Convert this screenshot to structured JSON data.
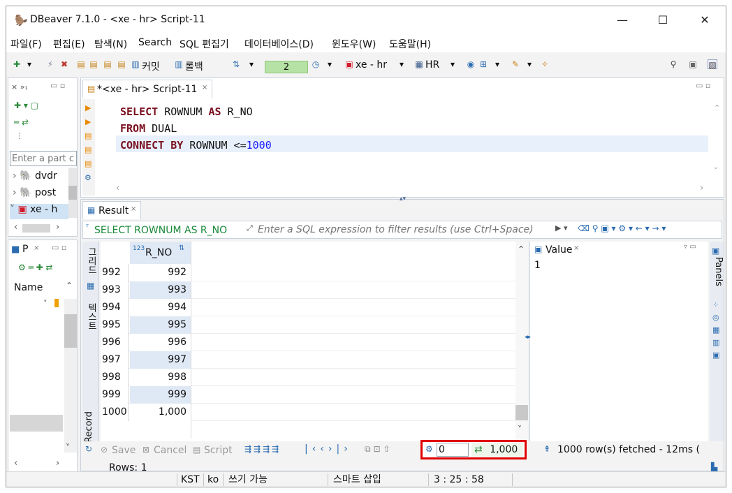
{
  "window": {
    "title": "DBeaver 7.1.0 - <xe - hr> Script-11",
    "controls": {
      "minimize": "—",
      "maximize": "☐",
      "close": "✕"
    }
  },
  "menu": [
    "파일(F)",
    "편집(E)",
    "탐색(N)",
    "Search",
    "SQL 편집기",
    "데이터베이스(D)",
    "윈도우(W)",
    "도움말(H)"
  ],
  "toolbar": {
    "commit_label": "커밋",
    "rollback_label": "롤백",
    "transaction_count": "2",
    "datasource": "xe - hr",
    "schema": "HR"
  },
  "navigator": {
    "filter_placeholder": "Enter a part c",
    "items": [
      "dvdr",
      "post",
      "xe - h"
    ]
  },
  "project_panel": {
    "tab": "P",
    "header": "Name"
  },
  "editor": {
    "tab_label": "*<xe - hr> Script-11",
    "lines": [
      [
        {
          "t": "SELECT",
          "k": "kw"
        },
        {
          "t": " ROWNUM ",
          "k": ""
        },
        {
          "t": "AS",
          "k": "kw"
        },
        {
          "t": " R_NO",
          "k": ""
        }
      ],
      [
        {
          "t": "FROM",
          "k": "kw"
        },
        {
          "t": " DUAL",
          "k": ""
        }
      ],
      [
        {
          "t": "CONNECT",
          "k": "kw"
        },
        {
          "t": " ",
          "k": ""
        },
        {
          "t": "BY",
          "k": "kw"
        },
        {
          "t": " ROWNUM <=",
          "k": ""
        },
        {
          "t": "1000",
          "k": "num"
        }
      ]
    ]
  },
  "result": {
    "tab_label": "Result",
    "query_text": "SELECT ROWNUM AS R_NO",
    "filter_placeholder": "Enter a SQL expression to filter results (use Ctrl+Space)",
    "column_header": "R_NO",
    "column_type_badge": "123",
    "side_tabs": {
      "grid": "그리드",
      "text": "텍스트",
      "record": "Record"
    },
    "rows": [
      {
        "num": "992",
        "value": "992"
      },
      {
        "num": "993",
        "value": "993"
      },
      {
        "num": "994",
        "value": "994"
      },
      {
        "num": "995",
        "value": "995"
      },
      {
        "num": "996",
        "value": "996"
      },
      {
        "num": "997",
        "value": "997"
      },
      {
        "num": "998",
        "value": "998"
      },
      {
        "num": "999",
        "value": "999"
      },
      {
        "num": "1000",
        "value": "1,000"
      }
    ],
    "buttons": {
      "save": "Save",
      "cancel": "Cancel",
      "script": "Script"
    },
    "fetch_offset": "0",
    "fetch_size": "1,000",
    "fetched_message": "1000 row(s) fetched - 12ms (",
    "rows_label": "Rows: 1"
  },
  "value_panel": {
    "tab": "Value",
    "value": "1",
    "side_label": "Panels"
  },
  "statusbar": {
    "timezone": "KST",
    "locale": "ko",
    "mode": "쓰기 가능",
    "insert": "스마트 삽입",
    "position": "3 : 25 : 58"
  },
  "colors": {
    "highlight_box": "#e00000",
    "keyword": "#7a0f1f",
    "number": "#1a1aff",
    "selected_row": "#dfe8f5",
    "current_line": "#e8f0fb"
  }
}
